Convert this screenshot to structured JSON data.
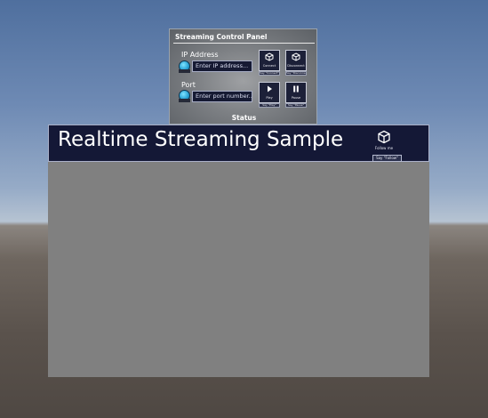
{
  "control_panel": {
    "title": "Streaming Control Panel",
    "ip_field": {
      "label": "IP Address",
      "placeholder": "Enter IP address..."
    },
    "port_field": {
      "label": "Port",
      "placeholder": "Enter port number..."
    },
    "buttons": [
      {
        "label": "Connect",
        "say": "Say \"Connect\"",
        "icon": "cube-icon"
      },
      {
        "label": "Disconnect",
        "say": "Say \"Disconnect\"",
        "icon": "cube-icon"
      },
      {
        "label": "Play",
        "say": "Say \"Play\"",
        "icon": "play-icon"
      },
      {
        "label": "Pause",
        "say": "Say \"Pause\"",
        "icon": "pause-icon"
      }
    ],
    "status_label": "Status"
  },
  "slate": {
    "title": "Realtime Streaming Sample",
    "follow_button": {
      "label": "Follow me",
      "say": "Say \"Follow\"",
      "icon": "cube-icon"
    }
  },
  "colors": {
    "panel_button_bg": "#1c2038",
    "slate_header_bg": "#141836",
    "slate_body_bg": "#808080",
    "field_icon": "#2aa4d6"
  }
}
